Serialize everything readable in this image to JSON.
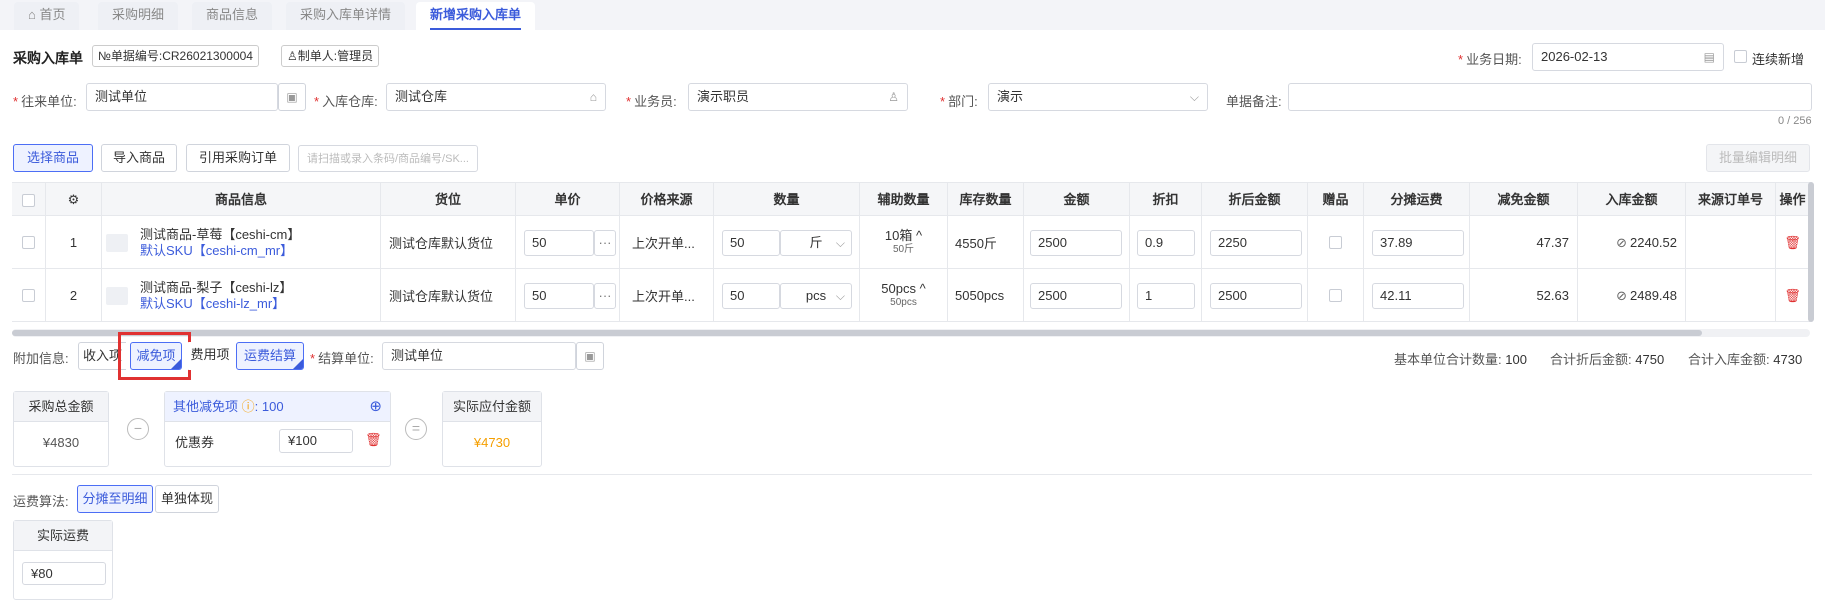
{
  "tabs": [
    "首页",
    "采购明细",
    "商品信息",
    "采购入库单详情",
    "新增采购入库单"
  ],
  "header": {
    "title": "采购入库单",
    "doc_no_label": "№单据编号:",
    "doc_no": "CR26021300004",
    "creator_label": "制单人:",
    "creator": "管理员",
    "biz_date_label": "业务日期:",
    "biz_date": "2026-02-13",
    "continue_label": "连续新增"
  },
  "form": {
    "partner_label": "往来单位:",
    "partner": "测试单位",
    "warehouse_label": "入库仓库:",
    "warehouse": "测试仓库",
    "salesman_label": "业务员:",
    "salesman": "演示职员",
    "dept_label": "部门:",
    "dept": "演示",
    "remark_label": "单据备注:",
    "remark_count": "0 / 256"
  },
  "toolbar": {
    "select_goods": "选择商品",
    "import_goods": "导入商品",
    "ref_order": "引用采购订单",
    "scan_placeholder": "请扫描或录入条码/商品编号/SK...",
    "batch_edit": "批量编辑明细"
  },
  "columns": [
    "商品信息",
    "货位",
    "单价",
    "价格来源",
    "数量",
    "辅助数量",
    "库存数量",
    "金额",
    "折扣",
    "折后金额",
    "赠品",
    "分摊运费",
    "减免金额",
    "入库金额",
    "来源订单号",
    "操作"
  ],
  "rows": [
    {
      "idx": "1",
      "name": "测试商品-草莓【ceshi-cm】",
      "sku": "默认SKU【ceshi-cm_mr】",
      "location": "测试仓库默认货位",
      "price": "50",
      "price_src": "上次开单...",
      "qty": "50",
      "unit": "斤",
      "aux_qty": "10箱",
      "aux_sub": "50斤",
      "stock": "4550斤",
      "amount": "2500",
      "discount": "0.9",
      "disc_amount": "2250",
      "freight": "37.89",
      "reduce": "47.37",
      "in_amount": "2240.52"
    },
    {
      "idx": "2",
      "name": "测试商品-梨子【ceshi-lz】",
      "sku": "默认SKU【ceshi-lz_mr】",
      "location": "测试仓库默认货位",
      "price": "50",
      "price_src": "上次开单...",
      "qty": "50",
      "unit": "pcs",
      "aux_qty": "50pcs",
      "aux_sub": "50pcs",
      "stock": "5050pcs",
      "amount": "2500",
      "discount": "1",
      "disc_amount": "2500",
      "freight": "42.11",
      "reduce": "52.63",
      "in_amount": "2489.48"
    }
  ],
  "extra": {
    "label": "附加信息:",
    "tab_income": "收入项",
    "tab_reduce": "减免项",
    "tab_fee": "费用项",
    "tab_freight": "运费结算",
    "settle_label": "结算单位:",
    "settle": "测试单位",
    "base_qty_label": "基本单位合计数量:",
    "base_qty": "100",
    "disc_total_label": "合计折后金额:",
    "disc_total": "4750",
    "in_total_label": "合计入库金额:",
    "in_total": "4730"
  },
  "calc": {
    "total_label": "采购总金额",
    "total": "¥4830",
    "other_reduce_label": "其他减免项",
    "other_reduce_value": ": 100",
    "coupon_label": "优惠券",
    "coupon_value": "¥100",
    "payable_label": "实际应付金额",
    "payable": "¥4730"
  },
  "freight": {
    "algo_label": "运费算法:",
    "opt_split": "分摊至明细",
    "opt_single": "单独体现",
    "actual_label": "实际运费",
    "actual_value": "¥80"
  },
  "colors": {
    "accent": "#3b5bdb",
    "required": "#e03131",
    "payable": "#f59f00",
    "highlight": "#e03131"
  }
}
